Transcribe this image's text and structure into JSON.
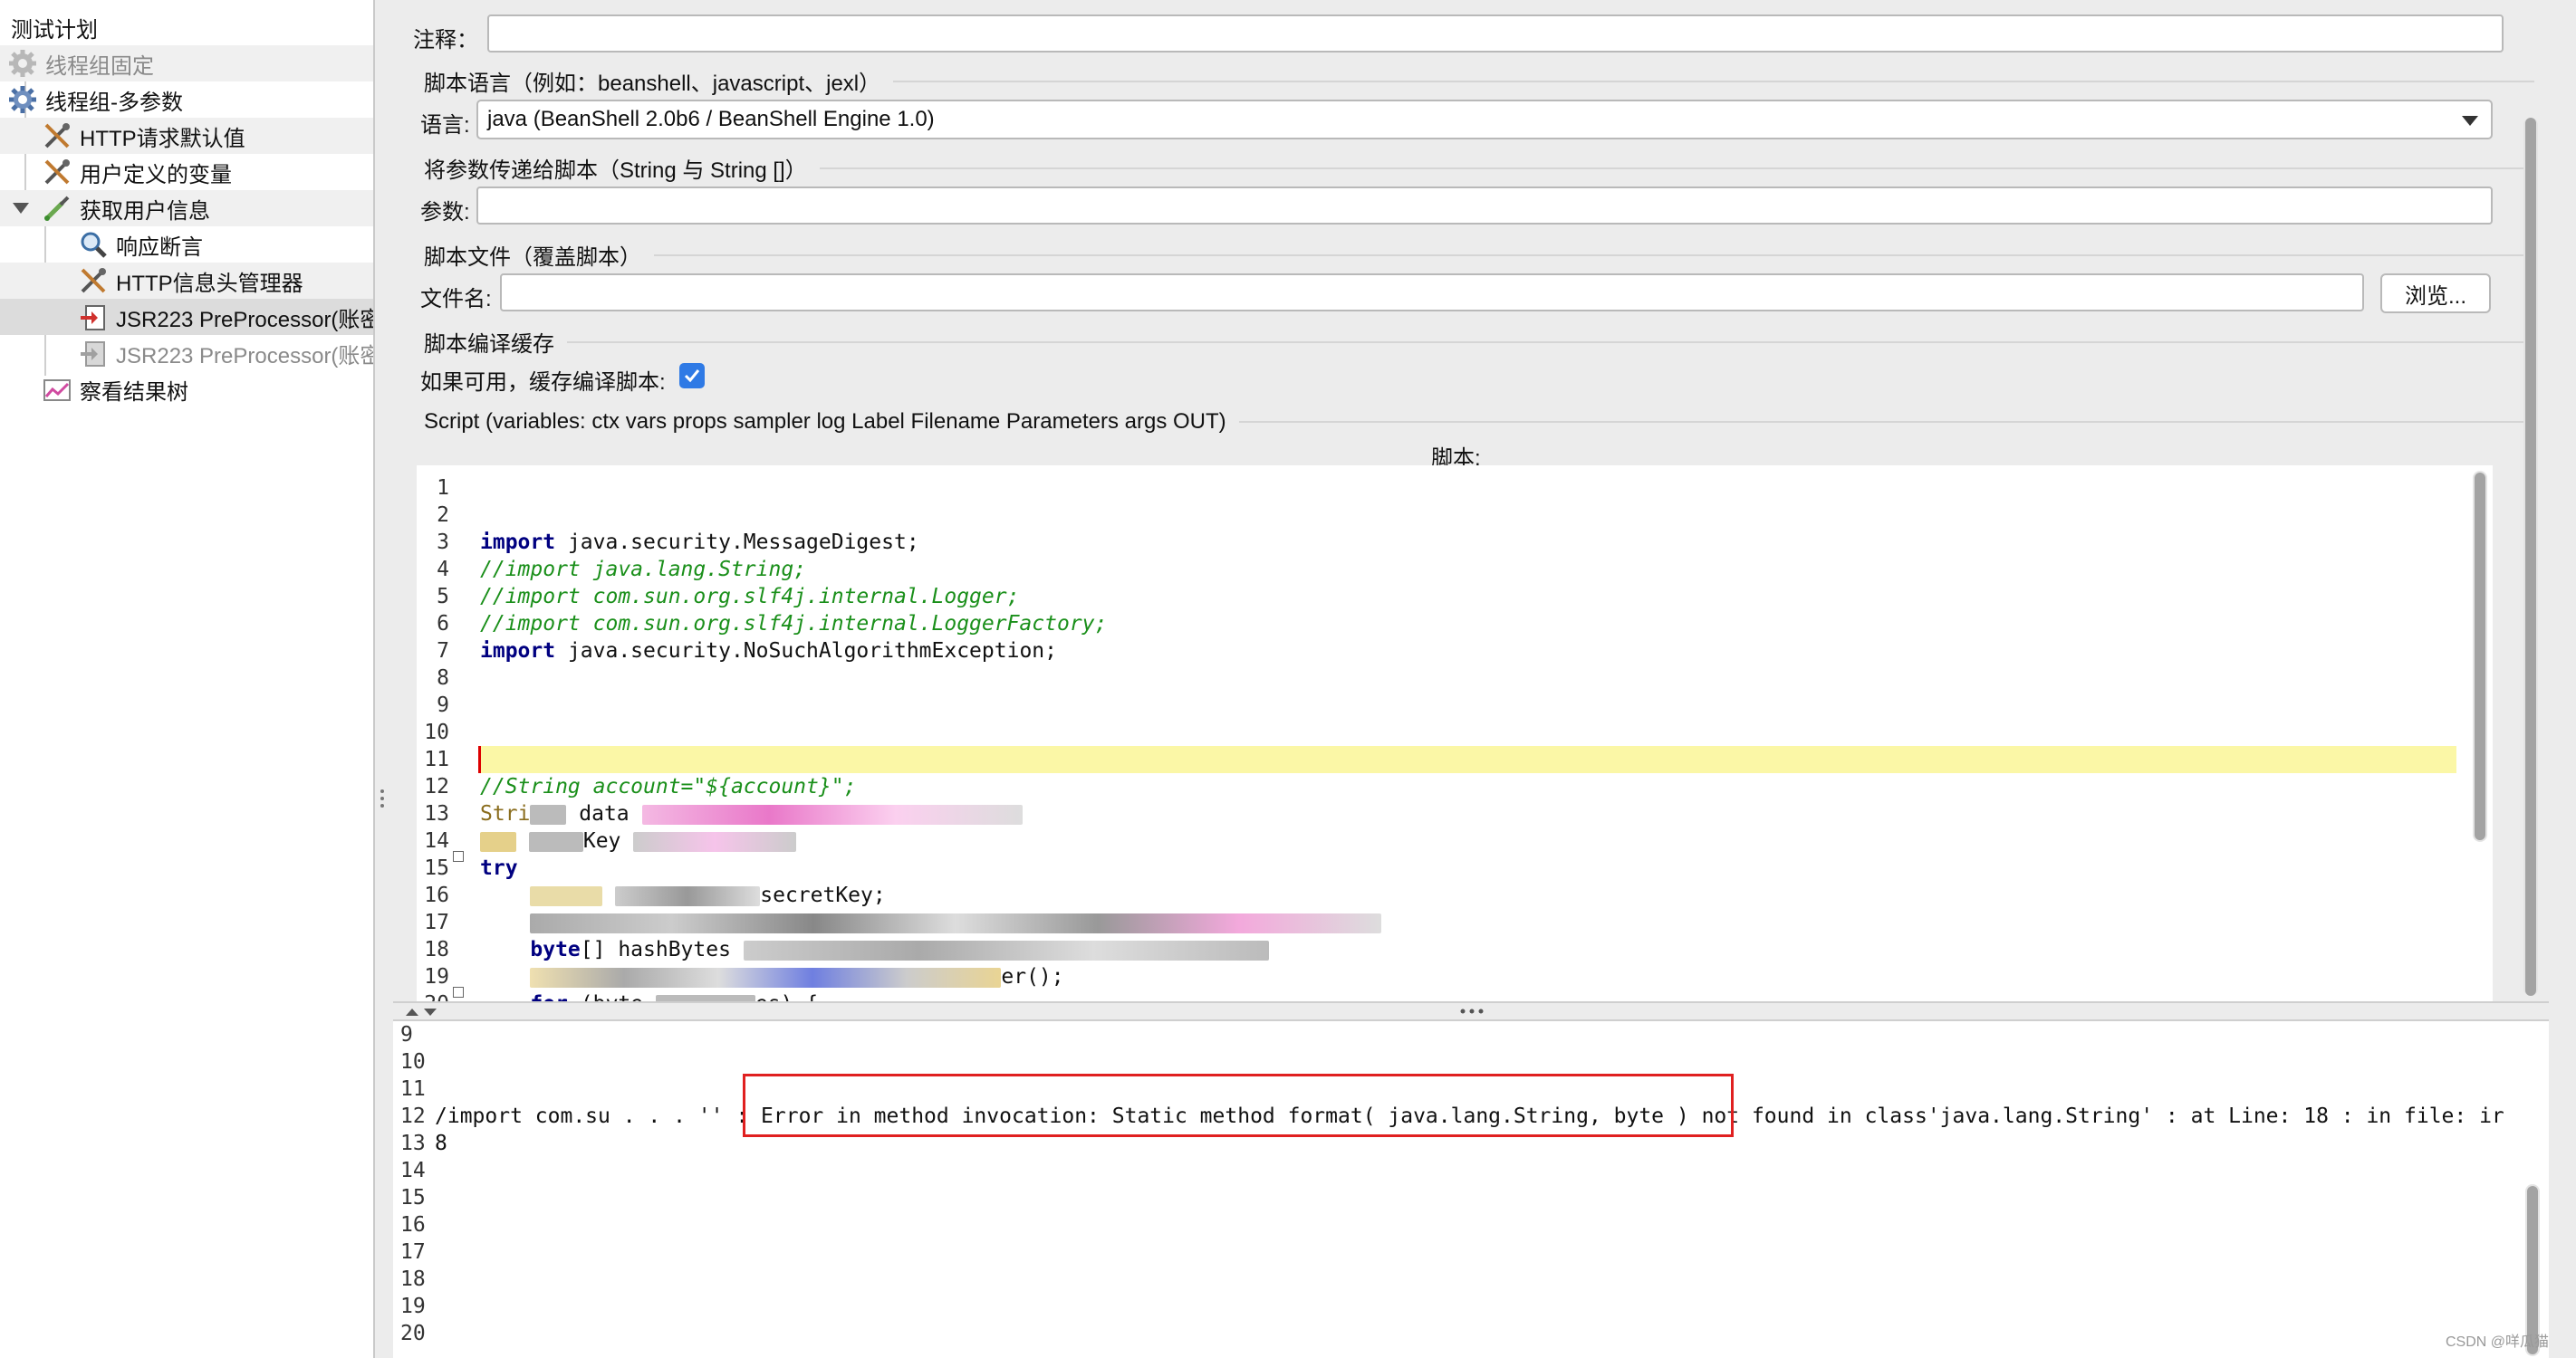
{
  "tree": {
    "items": [
      {
        "label": "测试计划",
        "icon": "test-plan-icon"
      },
      {
        "label": "线程组固定",
        "icon": "gear-icon"
      },
      {
        "label": "线程组-多参数",
        "icon": "gear-icon"
      },
      {
        "label": "HTTP请求默认值",
        "icon": "wrench-icon"
      },
      {
        "label": "用户定义的变量",
        "icon": "wrench-icon"
      },
      {
        "label": "获取用户信息",
        "icon": "pipette-icon"
      },
      {
        "label": "响应断言",
        "icon": "magnifier-icon"
      },
      {
        "label": "HTTP信息头管理器",
        "icon": "wrench-icon"
      },
      {
        "label": "JSR223 PreProcessor(账密",
        "icon": "preprocessor-icon"
      },
      {
        "label": "JSR223 PreProcessor(账密",
        "icon": "preprocessor-icon"
      },
      {
        "label": "察看结果树",
        "icon": "chart-icon"
      }
    ]
  },
  "form": {
    "comment_label": "注释：",
    "comment_value": "",
    "script_lang_section": "脚本语言（例如：beanshell、javascript、jexl）",
    "language_label": "语言:",
    "language_value": "java     (BeanShell 2.0b6 / BeanShell Engine 1.0)",
    "params_section": "将参数传递给脚本（String 与 String []）",
    "params_label": "参数:",
    "params_value": "",
    "script_file_section": "脚本文件（覆盖脚本）",
    "filename_label": "文件名:",
    "filename_value": "",
    "browse_button": "浏览...",
    "cache_section": "脚本编译缓存",
    "cache_label": "如果可用，缓存编译脚本:",
    "cache_checked": true,
    "script_section": "Script (variables: ctx vars props sampler log Label Filename Parameters args OUT)",
    "script_label": "脚本:"
  },
  "editor": {
    "line_numbers": [
      "1",
      "2",
      "3",
      "4",
      "5",
      "6",
      "7",
      "8",
      "9",
      "10",
      "11",
      "12",
      "13",
      "14",
      "15",
      "16",
      "17",
      "18",
      "19",
      "20"
    ],
    "lines": {
      "l3_kw": "import",
      "l3_rest": " java.security.MessageDigest;",
      "l4": "//import java.lang.String;",
      "l5": "//import com.sun.org.slf4j.internal.Logger;",
      "l6": "//import com.sun.org.slf4j.internal.LoggerFactory;",
      "l7_kw": "import",
      "l7_rest": " java.security.NoSuchAlgorithmException;",
      "l12": "//String account=\"${account}\";",
      "l13": "Stri",
      "l13b": "data",
      "l14b": "Key",
      "l15_kw": "try",
      "l16": "secretKey;",
      "l18_kw": "byte",
      "l18_rest": "[] hashBytes",
      "l19": "er();",
      "l20_kw": "for",
      "l20_rest": "(byte",
      "l20_end": "es) {"
    }
  },
  "output": {
    "line_numbers": [
      "9",
      "10",
      "11",
      "12",
      "13",
      "14",
      "15",
      "16",
      "17",
      "18",
      "19",
      "20"
    ],
    "line12": "/import com.su . . . '' : Error in method invocation: Static method format( java.lang.String, byte ) not found in class'java.lang.String' : at Line: 18 : in file: ir",
    "line13": "8"
  },
  "watermark": "CSDN @咩瓜猫"
}
